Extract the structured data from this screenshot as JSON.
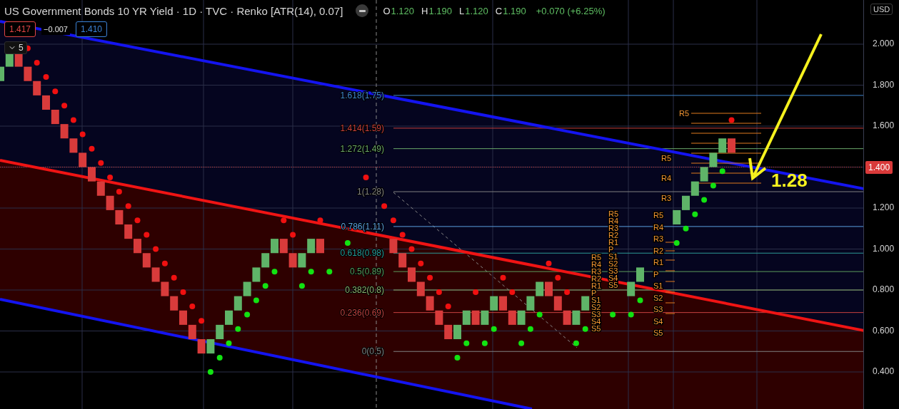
{
  "legend": {
    "title": "US Government Bonds 10 YR Yield · 1D · TVC · Renko [ATR(14), 0.07]",
    "ohlc": [
      {
        "label": "O",
        "value": "1.120"
      },
      {
        "label": "H",
        "value": "1.190"
      },
      {
        "label": "L",
        "value": "1.120"
      },
      {
        "label": "C",
        "value": "1.190"
      }
    ],
    "change": "+0.070 (+6.25%)",
    "sell_price": "1.417",
    "spread": "−0.007",
    "buy_price": "1.410",
    "indicators_count": "5"
  },
  "price_axis": {
    "currency": "USD",
    "ticks": [
      {
        "label": "2.000",
        "highlighted": false
      },
      {
        "label": "1.800",
        "highlighted": false
      },
      {
        "label": "1.600",
        "highlighted": false
      },
      {
        "label": "1.400",
        "highlighted": true
      },
      {
        "label": "1.200",
        "highlighted": false
      },
      {
        "label": "1.000",
        "highlighted": false
      },
      {
        "label": "0.800",
        "highlighted": false
      },
      {
        "label": "0.600",
        "highlighted": false
      },
      {
        "label": "0.400",
        "highlighted": false
      }
    ]
  },
  "fib_levels": [
    {
      "label": "1.618(1.75)",
      "color": "#3f86d0"
    },
    {
      "label": "1.414(1.59)",
      "color": "#c8413f"
    },
    {
      "label": "1.272(1.49)",
      "color": "#6aa76a"
    },
    {
      "label": "1(1.28)",
      "color": "#808080"
    },
    {
      "label": "0.786(1.11)",
      "color": "#5a9fe0"
    },
    {
      "label": "0.618(0.98)",
      "color": "#2c9b96"
    },
    {
      "label": "0.5(0.89)",
      "color": "#5c9c5c"
    },
    {
      "label": "0.382(0.8)",
      "color": "#8fb36e"
    },
    {
      "label": "0.236(0.69)",
      "color": "#c8413f"
    },
    {
      "label": "0(0.5)",
      "color": "#808080"
    }
  ],
  "pivot_groups": [
    {
      "labels": [
        "R5",
        "R4",
        "R3",
        "R2",
        "R1",
        "P",
        "S1",
        "S2",
        "S3",
        "S4",
        "S5"
      ]
    },
    {
      "labels": [
        "R5",
        "R4",
        "R3",
        "R2",
        "R1",
        "P",
        "S1",
        "S2",
        "S3",
        "S4",
        "S5"
      ]
    },
    {
      "labels": [
        "R5",
        "R4",
        "R3",
        "R2",
        "R1",
        "P",
        "S1",
        "S2",
        "S3",
        "S4",
        "S5"
      ]
    },
    {
      "labels": [
        "R5",
        "R4",
        "R3"
      ]
    },
    {
      "labels": [
        "R5"
      ]
    }
  ],
  "annotation": "1.28"
}
